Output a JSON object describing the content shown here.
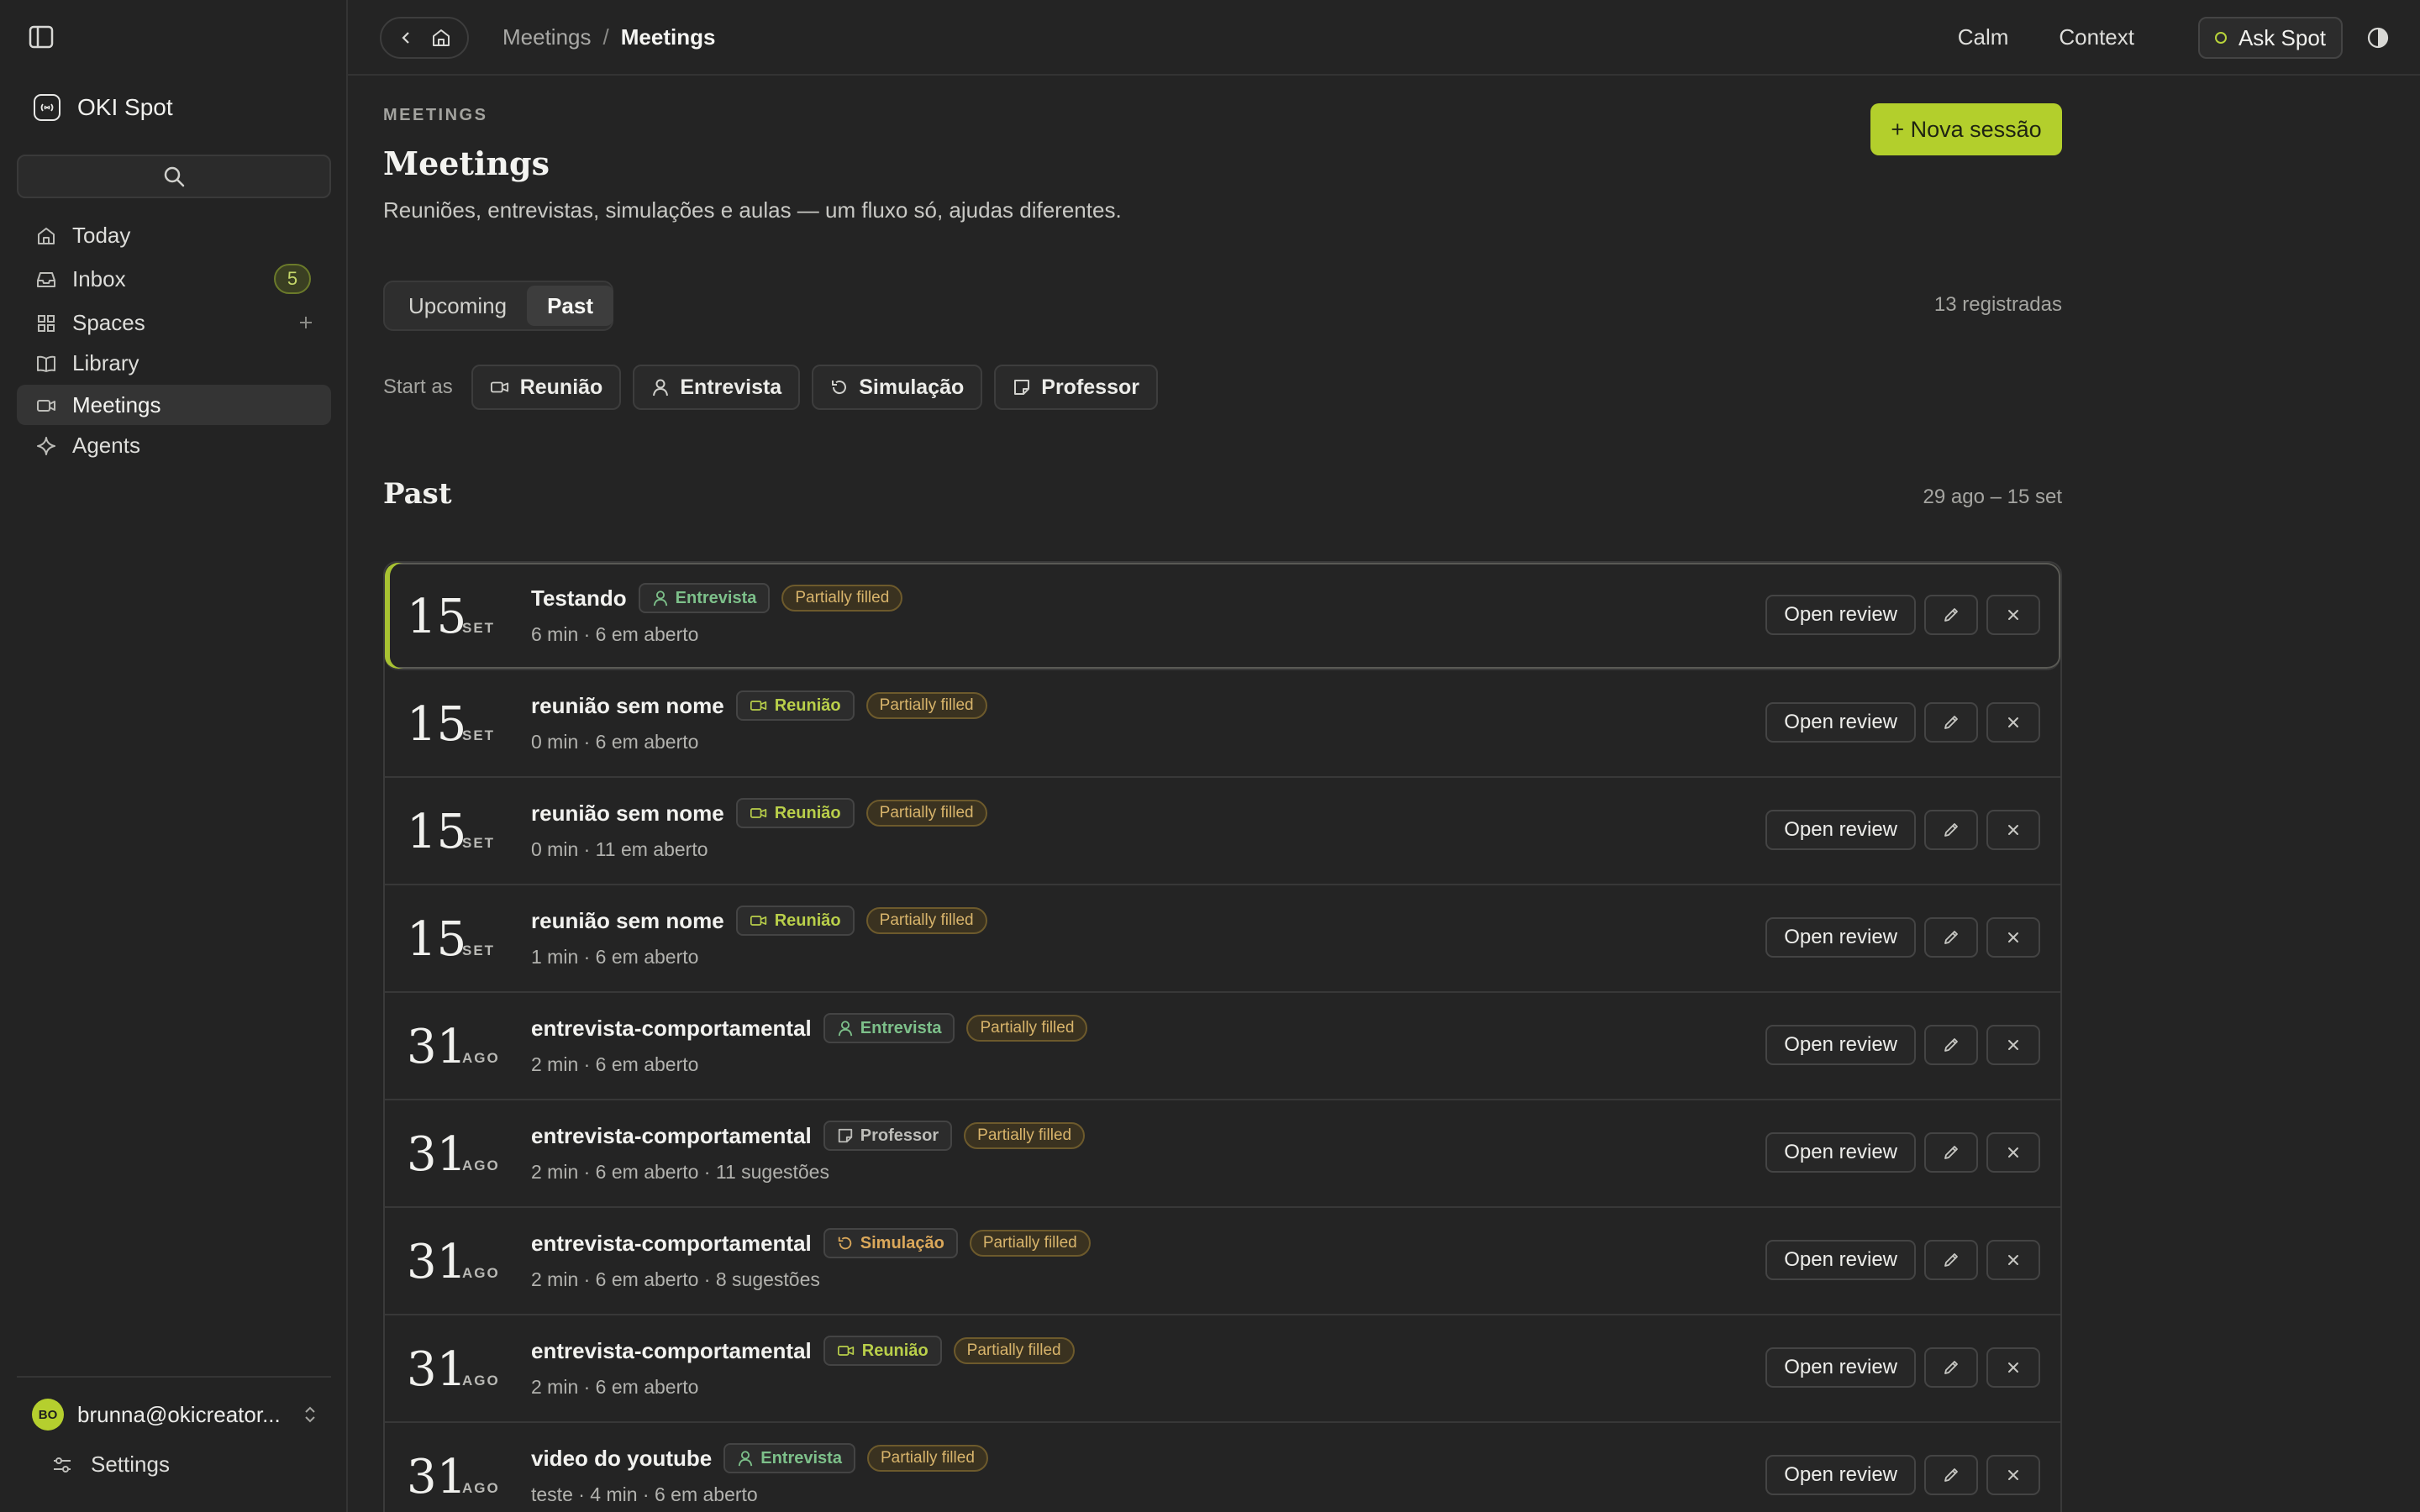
{
  "app": {
    "name": "OKI Spot"
  },
  "breadcrumb": {
    "parent": "Meetings",
    "separator": "/",
    "current": "Meetings"
  },
  "topbar": {
    "calm": "Calm",
    "context": "Context",
    "ask": "Ask Spot"
  },
  "sidebar": {
    "items": [
      {
        "label": "Today",
        "icon": "home-icon"
      },
      {
        "label": "Inbox",
        "icon": "inbox-icon",
        "badge": "5"
      },
      {
        "label": "Spaces",
        "icon": "grid-icon"
      },
      {
        "label": "Library",
        "icon": "book-icon"
      },
      {
        "label": "Meetings",
        "icon": "video-icon",
        "active": true
      },
      {
        "label": "Agents",
        "icon": "sparkle-icon"
      }
    ],
    "user": {
      "initials": "BO",
      "email": "brunna@okicreator..."
    },
    "settings": "Settings"
  },
  "header": {
    "eyebrow": "MEETINGS",
    "title": "Meetings",
    "description": "Reuniões, entrevistas, simulações e aulas — um fluxo só, ajudas diferentes.",
    "new_session": "+ Nova sessão"
  },
  "tabs": [
    {
      "label": "Upcoming"
    },
    {
      "label": "Past",
      "active": true
    }
  ],
  "count": "13 registradas",
  "start_as": {
    "label": "Start as",
    "chips": [
      {
        "label": "Reunião",
        "icon": "video-icon"
      },
      {
        "label": "Entrevista",
        "icon": "user-icon"
      },
      {
        "label": "Simulação",
        "icon": "refresh-icon"
      },
      {
        "label": "Professor",
        "icon": "note-icon"
      }
    ]
  },
  "section": {
    "title": "Past",
    "range": "29 ago – 15 set"
  },
  "row_labels": {
    "open_review": "Open review"
  },
  "meetings": [
    {
      "day": "15",
      "month": "SET",
      "title": "Testando",
      "tag": "Entrevista",
      "tag_type": "green",
      "status": "Partially filled",
      "meta": "6 min · 6 em aberto"
    },
    {
      "day": "15",
      "month": "SET",
      "title": "reunião sem nome",
      "tag": "Reunião",
      "tag_type": "lime",
      "status": "Partially filled",
      "meta": "0 min · 6 em aberto"
    },
    {
      "day": "15",
      "month": "SET",
      "title": "reunião sem nome",
      "tag": "Reunião",
      "tag_type": "lime",
      "status": "Partially filled",
      "meta": "0 min · 11 em aberto"
    },
    {
      "day": "15",
      "month": "SET",
      "title": "reunião sem nome",
      "tag": "Reunião",
      "tag_type": "lime",
      "status": "Partially filled",
      "meta": "1 min · 6 em aberto"
    },
    {
      "day": "31",
      "month": "AGO",
      "title": "entrevista-comportamental",
      "tag": "Entrevista",
      "tag_type": "green",
      "status": "Partially filled",
      "meta": "2 min · 6 em aberto"
    },
    {
      "day": "31",
      "month": "AGO",
      "title": "entrevista-comportamental",
      "tag": "Professor",
      "tag_type": "gray",
      "status": "Partially filled",
      "meta": "2 min · 6 em aberto · 11 sugestões"
    },
    {
      "day": "31",
      "month": "AGO",
      "title": "entrevista-comportamental",
      "tag": "Simulação",
      "tag_type": "orange",
      "status": "Partially filled",
      "meta": "2 min · 6 em aberto · 8 sugestões"
    },
    {
      "day": "31",
      "month": "AGO",
      "title": "entrevista-comportamental",
      "tag": "Reunião",
      "tag_type": "lime",
      "status": "Partially filled",
      "meta": "2 min · 6 em aberto"
    },
    {
      "day": "31",
      "month": "AGO",
      "title": "video do youtube",
      "tag": "Entrevista",
      "tag_type": "green",
      "status": "Partially filled",
      "meta": "teste · 4 min · 6 em aberto"
    }
  ],
  "colors": {
    "accent": "#b3cf2c",
    "background": "#242424",
    "status": "#d8b46b"
  }
}
